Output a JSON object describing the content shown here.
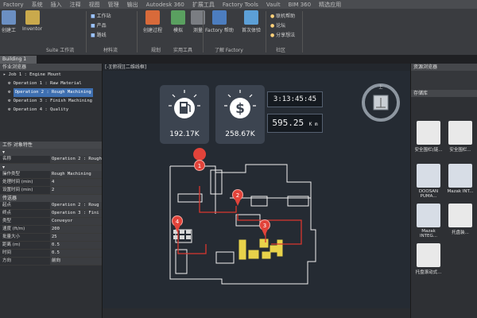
{
  "menu": [
    "Factory",
    "系统",
    "插入",
    "注释",
    "视图",
    "管理",
    "输出",
    "Autodesk 360",
    "扩展工具",
    "Factory Tools",
    "Vault",
    "BIM 360",
    "精选应用"
  ],
  "ribbon": {
    "buttons": [
      {
        "label": "创建工"
      },
      {
        "label": "Inventor"
      },
      {
        "label": "工作站"
      },
      {
        "label": "产品"
      },
      {
        "label": "路线"
      },
      {
        "label": "创建过程"
      },
      {
        "label": "模拟"
      },
      {
        "label": "测量"
      },
      {
        "label": "刷新"
      },
      {
        "label": "Factory 帮助"
      },
      {
        "label": "首次体验"
      },
      {
        "label": "联机帮助"
      },
      {
        "label": "论坛"
      },
      {
        "label": "分享想法"
      }
    ],
    "groups": [
      "Suite 工作流",
      "材料流",
      "规划",
      "实用工具",
      "了解 Factory",
      "社区"
    ]
  },
  "doc_tab": "Building 1",
  "left_panel": {
    "title": "作业浏览器",
    "tree": [
      "Job 1 : Engine Mount",
      "Operation 1 : Raw Material",
      "Operation 2 : Rough Machining",
      "Operation 3 : Finish Machining",
      "Operation 4 : Quality"
    ],
    "selected_index": 2,
    "props_title": "工作 对象特性",
    "props": [
      {
        "k": "名称",
        "v": "Operation 2 : Rough"
      },
      {
        "k": "操作类型",
        "v": "Rough Machining"
      },
      {
        "k": "处理时间 (min)",
        "v": "4"
      },
      {
        "k": "设置时间 (min)",
        "v": "2"
      }
    ],
    "section2": "传送器",
    "props2": [
      {
        "k": "起点",
        "v": "Operation 2 : Roug"
      },
      {
        "k": "终点",
        "v": "Operation 3 : Fini"
      },
      {
        "k": "类型",
        "v": "Conveyor"
      },
      {
        "k": "速度 (ft/m)",
        "v": "200"
      },
      {
        "k": "批量大小",
        "v": "25"
      },
      {
        "k": "距离 (m)",
        "v": "0.5"
      },
      {
        "k": "时间",
        "v": "0.5"
      },
      {
        "k": "方向",
        "v": "前向"
      }
    ]
  },
  "canvas": {
    "header": "[-][俯视][二维线框]",
    "kpi_cost": "192.17K",
    "kpi_revenue": "258.67K",
    "time": "3:13:45:45",
    "distance": "595.25",
    "distance_unit": "K m",
    "markers": [
      "1",
      "2",
      "3",
      "4"
    ],
    "compass_label": "上"
  },
  "right_panel": {
    "title": "资源浏览器",
    "tab": "存储库",
    "items": [
      "安全围栏(链...",
      "安全围栏...",
      "DOOSAN PUMA...",
      "Mazak INT...",
      "Mazak INTEG...",
      "托盘装...",
      "托盘滚动式..."
    ]
  },
  "colors": {
    "accent": "#3e6fb0",
    "marker": "#e2433a",
    "route": "#d9362e",
    "layout_line": "#ffffff",
    "machine": "#e8d24a"
  }
}
